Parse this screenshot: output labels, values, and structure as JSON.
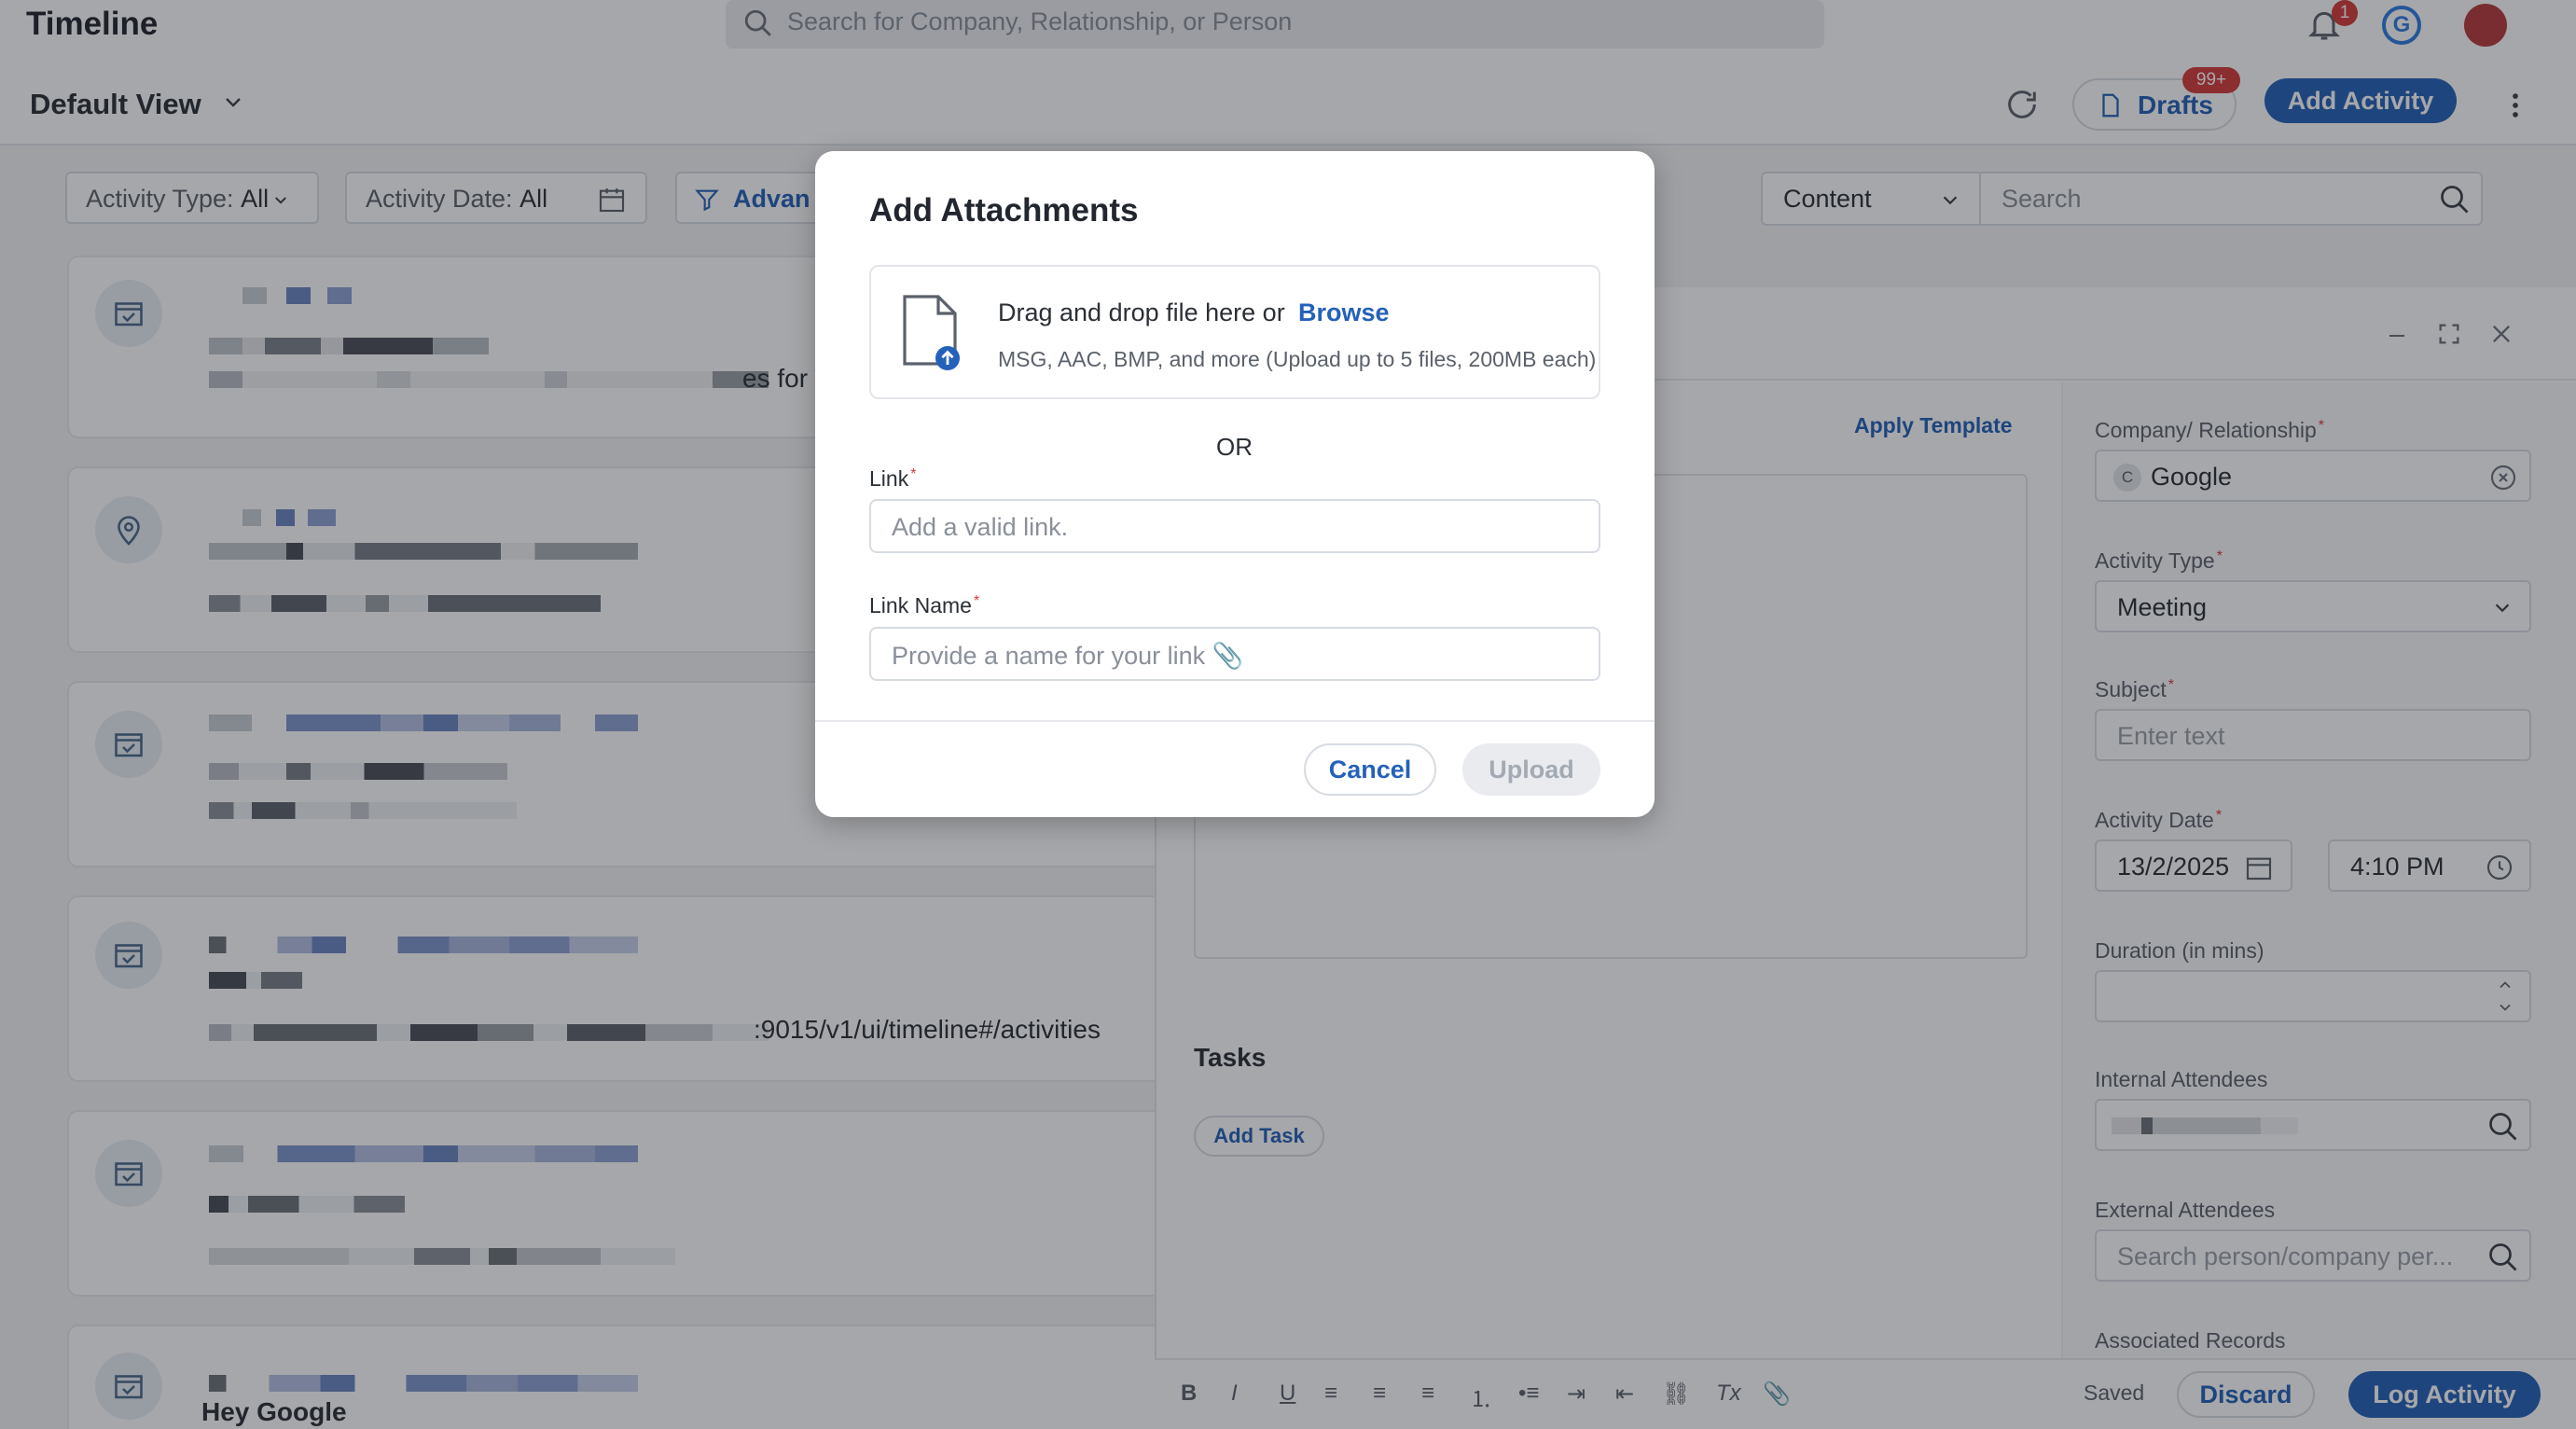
{
  "header": {
    "title": "Timeline",
    "search_placeholder": "Search for Company, Relationship, or Person",
    "notification_count": "1",
    "user_initial": "G"
  },
  "viewbar": {
    "view_name": "Default View",
    "drafts_label": "Drafts",
    "drafts_count": "99+",
    "add_activity_label": "Add Activity"
  },
  "filters": {
    "activity_type_label": "Activity Type:",
    "activity_type_value": "All",
    "activity_date_label": "Activity Date:",
    "activity_date_value": "All",
    "advanced_label": "Advan",
    "content_select_value": "Content",
    "search_placeholder": "Search"
  },
  "timeline": {
    "card1_partial_text": "es for T",
    "card4_url_text": ":9015/v1/ui/timeline#/activities",
    "card6_text": "Hey Google"
  },
  "compose": {
    "apply_template_label": "Apply Template",
    "tasks_title": "Tasks",
    "add_task_label": "Add Task",
    "fields": {
      "company_label": "Company/ Relationship",
      "company_value": "Google",
      "company_initial": "C",
      "activity_type_label": "Activity Type",
      "activity_type_value": "Meeting",
      "subject_label": "Subject",
      "subject_placeholder": "Enter text",
      "activity_date_label": "Activity Date",
      "date_value": "13/2/2025",
      "time_value": "4:10 PM",
      "duration_label": "Duration (in mins)",
      "internal_attendees_label": "Internal Attendees",
      "external_attendees_label": "External Attendees",
      "external_attendees_placeholder": "Search person/company per...",
      "associated_records_label": "Associated Records"
    },
    "saved_label": "Saved",
    "discard_label": "Discard",
    "log_activity_label": "Log Activity"
  },
  "modal": {
    "title": "Add Attachments",
    "drop_text": "Drag and drop file here or",
    "browse_label": "Browse",
    "drop_subtext": "MSG, AAC, BMP, and more (Upload up to 5 files, 200MB each)",
    "or_text": "OR",
    "link_label": "Link",
    "link_placeholder": "Add a valid link.",
    "link_name_label": "Link Name",
    "link_name_placeholder": "Provide a name for your link 📎",
    "cancel_label": "Cancel",
    "upload_label": "Upload"
  },
  "colors": {
    "accent": "#2461b9",
    "danger": "#d63a3a"
  }
}
